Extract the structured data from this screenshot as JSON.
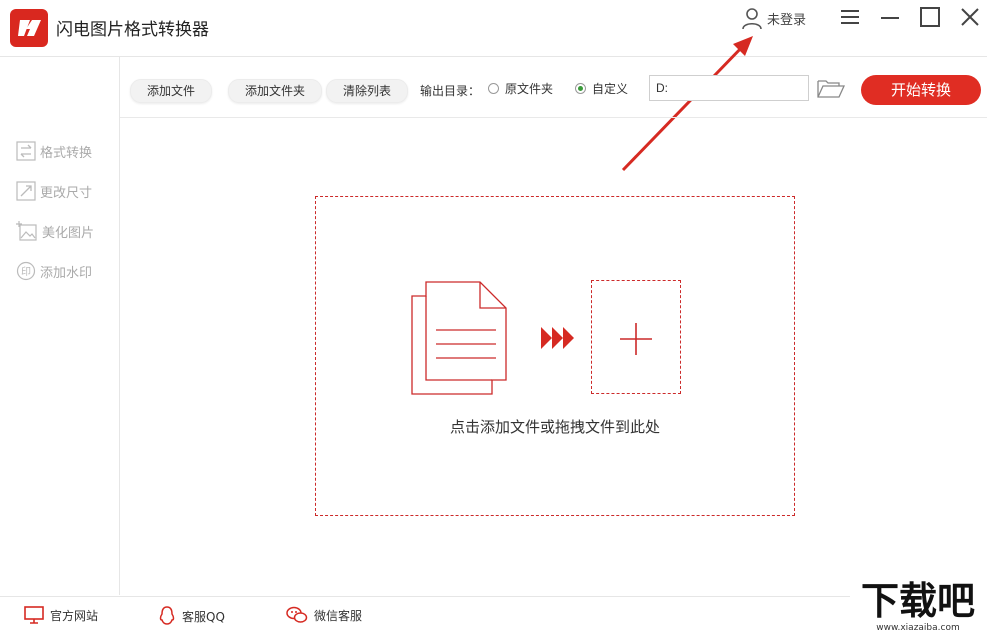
{
  "app": {
    "title": "闪电图片格式转换器",
    "logo_icon": "lightning-logo-icon",
    "accent": "#e02d23"
  },
  "header": {
    "login_label": "未登录"
  },
  "window_controls": [
    "menu-icon",
    "minimize-icon",
    "maximize-icon",
    "close-icon"
  ],
  "sidebar": {
    "items": [
      {
        "label": "格式转换",
        "icon": "swap-icon"
      },
      {
        "label": "更改尺寸",
        "icon": "resize-icon"
      },
      {
        "label": "美化图片",
        "icon": "image-sparkle-icon"
      },
      {
        "label": "添加水印",
        "icon": "stamp-icon"
      }
    ]
  },
  "toolbar": {
    "add_file": "添加文件",
    "add_folder": "添加文件夹",
    "clear_list": "清除列表",
    "output_label": "输出目录：",
    "radio_original": "原文件夹",
    "radio_custom": "自定义",
    "selected": "自定义",
    "path_value": "D:",
    "start_button": "开始转换"
  },
  "dropzone": {
    "hint": "点击添加文件或拖拽文件到此处"
  },
  "footer": {
    "website": "官方网站",
    "qq": "客服QQ",
    "wechat": "微信客服"
  },
  "watermark": {
    "brand": "下载吧",
    "url": "www.xiazaiba.com"
  }
}
